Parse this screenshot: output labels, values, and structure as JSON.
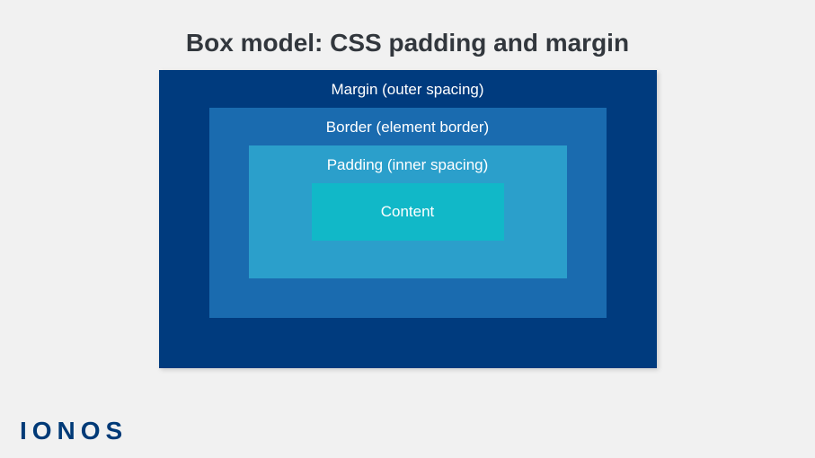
{
  "title": "Box model: CSS padding and margin",
  "layers": {
    "margin": {
      "label": "Margin (outer spacing)",
      "color": "#003b7e"
    },
    "border": {
      "label": "Border (element border)",
      "color": "#1a6baf"
    },
    "padding": {
      "label": "Padding (inner spacing)",
      "color": "#2b9fcb"
    },
    "content": {
      "label": "Content",
      "color": "#11b8c8"
    }
  },
  "brand": "IONOS"
}
